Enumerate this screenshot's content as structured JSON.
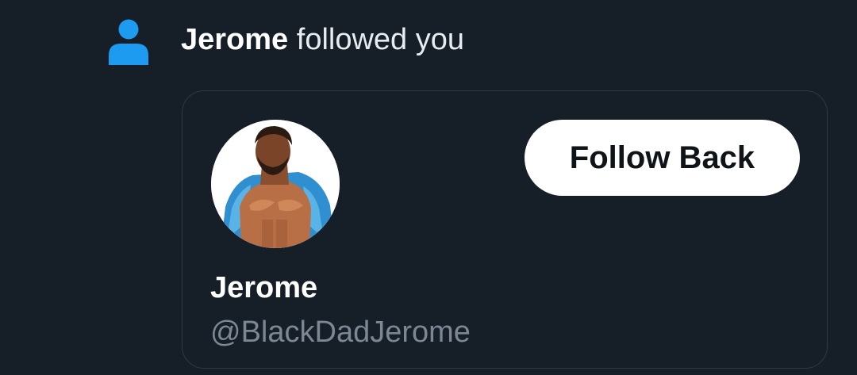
{
  "notification": {
    "icon": "person-icon",
    "icon_color": "#1d9bf0",
    "actor": "Jerome",
    "action_text": " followed you"
  },
  "user_card": {
    "avatar": "profile-avatar",
    "display_name": "Jerome",
    "handle": "@BlackDadJerome",
    "follow_back_label": "Follow Back"
  },
  "colors": {
    "background": "#161e28",
    "card_border": "#2f3a47",
    "handle_text": "#7b8793",
    "button_bg": "#ffffff",
    "button_text": "#0f1419"
  }
}
